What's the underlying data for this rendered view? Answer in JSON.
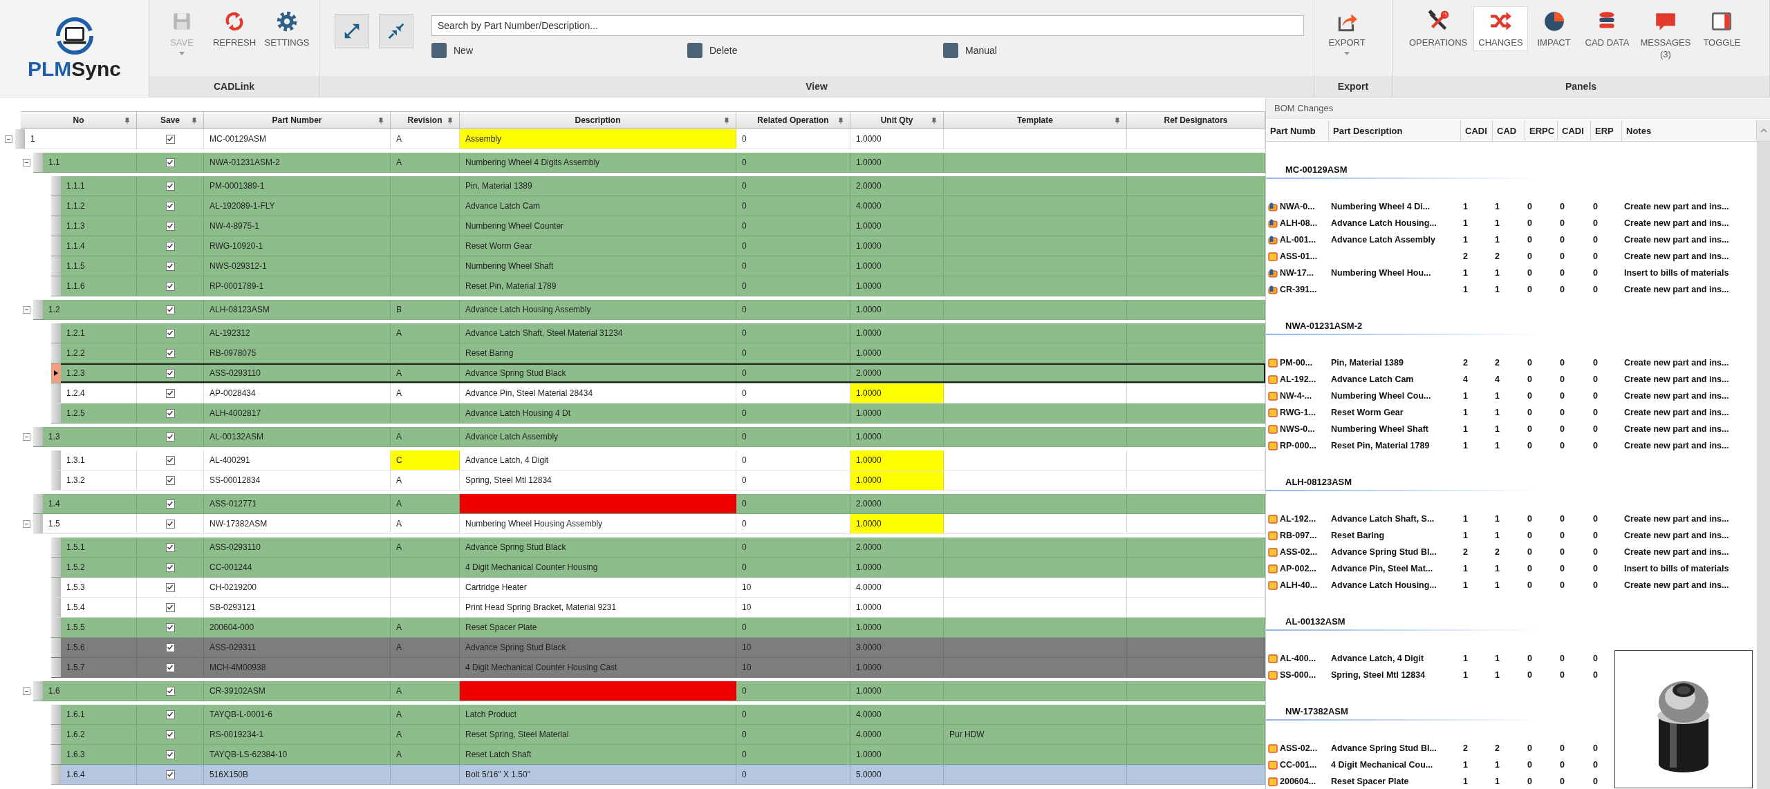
{
  "logo": {
    "accent": "PLM",
    "text": "Sync"
  },
  "ribbon": {
    "cadlink": {
      "label": "CADLink",
      "tools": [
        {
          "label": "SAVE",
          "disabled": true,
          "dropdown": true
        },
        {
          "label": "REFRESH",
          "disabled": false,
          "dropdown": false
        },
        {
          "label": "SETTINGS",
          "disabled": false,
          "dropdown": false
        }
      ]
    },
    "view": {
      "label": "View",
      "search": {
        "placeholder": "Search by Part Number/Description..."
      },
      "filters": [
        {
          "label": "New",
          "checked": false
        },
        {
          "label": "Delete",
          "checked": false
        },
        {
          "label": "Manual",
          "checked": false
        }
      ]
    },
    "export": {
      "label": "Export",
      "tools": [
        {
          "label": "EXPORT",
          "disabled": false,
          "dropdown": true
        }
      ]
    },
    "panels": {
      "label": "Panels",
      "tools": [
        {
          "label": "OPERATIONS",
          "selected": false
        },
        {
          "label": "CHANGES",
          "selected": true
        },
        {
          "label": "IMPACT",
          "selected": false
        },
        {
          "label": "CAD DATA",
          "selected": false
        },
        {
          "label": "MESSAGES",
          "count": "(3)",
          "selected": false
        },
        {
          "label": "TOGGLE",
          "selected": false
        }
      ]
    }
  },
  "grid": {
    "columns": [
      {
        "label": "No",
        "pinned": true
      },
      {
        "label": "Save",
        "pinned": true
      },
      {
        "label": "Part Number",
        "pinned": true
      },
      {
        "label": "Revision",
        "pinned": true
      },
      {
        "label": "Description",
        "pinned": true
      },
      {
        "label": "Related Operation",
        "pinned": true
      },
      {
        "label": "Unit Qty",
        "pinned": true
      },
      {
        "label": "Template",
        "pinned": true
      },
      {
        "label": "Ref Designators",
        "pinned": false
      }
    ],
    "rows": [
      {
        "no": "1",
        "save": true,
        "part_number": "MC-00129ASM",
        "revision": "A",
        "description": {
          "text": "Assembly",
          "color": "#ffff00"
        },
        "related_operation": "0",
        "unit_qty": "1.0000",
        "color": "#ffffff",
        "selected": false,
        "expanded": true,
        "children": [
          {
            "no": "1.1",
            "save": true,
            "part_number": "NWA-01231ASM-2",
            "revision": "A",
            "description": "Numbering Wheel 4 Digits Assembly",
            "related_operation": "0",
            "unit_qty": "1.0000",
            "color": "#8dbd8b",
            "selected": false,
            "expanded": true,
            "children": [
              {
                "no": "1.1.1",
                "save": true,
                "part_number": "PM-0001389-1",
                "description": "Pin, Material 1389",
                "related_operation": "0",
                "unit_qty": "2.0000",
                "color": "#8dbd8b",
                "selected": false
              },
              {
                "no": "1.1.2",
                "save": true,
                "part_number": "AL-192089-1-FLY",
                "description": "Advance Latch Cam",
                "related_operation": "0",
                "unit_qty": "4.0000",
                "color": "#8dbd8b",
                "selected": false
              },
              {
                "no": "1.1.3",
                "save": true,
                "part_number": "NW-4-8975-1",
                "description": "Numbering Wheel Counter",
                "related_operation": "0",
                "unit_qty": "1.0000",
                "color": "#8dbd8b",
                "selected": false
              },
              {
                "no": "1.1.4",
                "save": true,
                "part_number": "RWG-10920-1",
                "description": "Reset Worm Gear",
                "related_operation": "0",
                "unit_qty": "1.0000",
                "color": "#8dbd8b",
                "selected": false
              },
              {
                "no": "1.1.5",
                "save": true,
                "part_number": "NWS-029312-1",
                "description": "Numbering Wheel Shaft",
                "related_operation": "0",
                "unit_qty": "1.0000",
                "color": "#8dbd8b",
                "selected": false
              },
              {
                "no": "1.1.6",
                "save": true,
                "part_number": "RP-0001789-1",
                "description": "Reset Pin, Material 1789",
                "related_operation": "0",
                "unit_qty": "1.0000",
                "color": "#8dbd8b",
                "selected": false
              }
            ]
          },
          {
            "no": "1.2",
            "save": true,
            "part_number": "ALH-08123ASM",
            "revision": "B",
            "description": "Advance Latch Housing Assembly",
            "related_operation": "0",
            "unit_qty": "1.0000",
            "color": "#8dbd8b",
            "selected": false,
            "expanded": true,
            "children": [
              {
                "no": "1.2.1",
                "save": true,
                "part_number": "AL-192312",
                "revision": "A",
                "description": "Advance Latch Shaft, Steel Material 31234",
                "related_operation": "0",
                "unit_qty": "1.0000",
                "color": "#8dbd8b",
                "selected": false
              },
              {
                "no": "1.2.2",
                "save": true,
                "part_number": "RB-0978075",
                "description": "Reset  Baring",
                "related_operation": "0",
                "unit_qty": "1.0000",
                "color": "#8dbd8b",
                "selected": false
              },
              {
                "no": "1.2.3",
                "save": true,
                "part_number": "ASS-0293110",
                "revision": "A",
                "description": "Advance Spring Stud Black",
                "related_operation": "0",
                "unit_qty": "2.0000",
                "color": "#8dbd8b",
                "selected": true
              },
              {
                "no": "1.2.4",
                "save": true,
                "part_number": "AP-0028434",
                "revision": "A",
                "description": "Advance Pin, Steel Material 28434",
                "related_operation": "0",
                "unit_qty": {
                  "text": "1.0000",
                  "color": "#ffff00"
                },
                "color": "#ffffff",
                "selected": false
              },
              {
                "no": "1.2.5",
                "save": true,
                "part_number": "ALH-4002817",
                "description": "Advance Latch Housing 4 Dt",
                "related_operation": "0",
                "unit_qty": "1.0000",
                "color": "#8dbd8b",
                "selected": false
              }
            ]
          },
          {
            "no": "1.3",
            "save": true,
            "part_number": "AL-00132ASM",
            "revision": "A",
            "description": "Advance Latch Assembly",
            "related_operation": "0",
            "unit_qty": "1.0000",
            "color": "#8dbd8b",
            "selected": false,
            "expanded": true,
            "children": [
              {
                "no": "1.3.1",
                "save": true,
                "part_number": "AL-400291",
                "revision": {
                  "text": "C",
                  "color": "#ffff00"
                },
                "description": "Advance Latch, 4 Digit",
                "related_operation": "0",
                "unit_qty": {
                  "text": "1.0000",
                  "color": "#ffff00"
                },
                "color": "#ffffff",
                "selected": false
              },
              {
                "no": "1.3.2",
                "save": true,
                "part_number": "SS-00012834",
                "revision": "A",
                "description": "Spring, Steel Mtl 12834",
                "related_operation": "0",
                "unit_qty": {
                  "text": "1.0000",
                  "color": "#ffff00"
                },
                "color": "#ffffff",
                "selected": false
              }
            ]
          },
          {
            "no": "1.4",
            "save": true,
            "part_number": "ASS-012771",
            "revision": "A",
            "description": {
              "color": "#ee0000"
            },
            "related_operation": "0",
            "unit_qty": "2.0000",
            "color": "#8dbd8b",
            "selected": false
          },
          {
            "no": "1.5",
            "save": true,
            "part_number": "NW-17382ASM",
            "revision": "A",
            "description": "Numbering Wheel Housing Assembly",
            "related_operation": "0",
            "unit_qty": {
              "text": "1.0000",
              "color": "#ffff00"
            },
            "color": "#ffffff",
            "selected": false,
            "expanded": true,
            "children": [
              {
                "no": "1.5.1",
                "save": true,
                "part_number": "ASS-0293110",
                "revision": "A",
                "description": "Advance Spring Stud Black",
                "related_operation": "0",
                "unit_qty": "2.0000",
                "color": "#8dbd8b",
                "selected": false
              },
              {
                "no": "1.5.2",
                "save": true,
                "part_number": "CC-001244",
                "description": "4 Digit Mechanical Counter Housing",
                "related_operation": "0",
                "unit_qty": "1.0000",
                "color": "#8dbd8b",
                "selected": false
              },
              {
                "no": "1.5.3",
                "save": true,
                "part_number": "CH-0219200",
                "description": "Cartridge Heater",
                "related_operation": "10",
                "unit_qty": "4.0000",
                "color": "#ffffff",
                "selected": false
              },
              {
                "no": "1.5.4",
                "save": true,
                "part_number": "SB-0293121",
                "description": "Print Head Spring Bracket, Material 9231",
                "related_operation": "10",
                "unit_qty": "1.0000",
                "color": "#ffffff",
                "selected": false
              },
              {
                "no": "1.5.5",
                "save": true,
                "part_number": "200604-000",
                "revision": "A",
                "description": "Reset Spacer Plate",
                "related_operation": "0",
                "unit_qty": "1.0000",
                "color": "#8dbd8b",
                "selected": false
              },
              {
                "no": "1.5.6",
                "save": true,
                "part_number": "ASS-029311",
                "revision": "A",
                "description": "Advance Spring Stud Black",
                "related_operation": "10",
                "unit_qty": "3.0000",
                "color": "#7d7d7d",
                "selected": false
              },
              {
                "no": "1.5.7",
                "save": true,
                "part_number": "MCH-4M00938",
                "description": "4 Digit Mechanical Counter Housing Cast",
                "related_operation": "10",
                "unit_qty": "1.0000",
                "color": "#7d7d7d",
                "selected": false
              }
            ]
          },
          {
            "no": "1.6",
            "save": true,
            "part_number": "CR-39102ASM",
            "revision": "A",
            "description": {
              "color": "#ee0000"
            },
            "related_operation": "0",
            "unit_qty": "1.0000",
            "color": "#8dbd8b",
            "selected": false,
            "expanded": true,
            "children": [
              {
                "no": "1.6.1",
                "save": true,
                "part_number": "TAYQB-L-0001-6",
                "revision": "A",
                "description": "Latch Product",
                "related_operation": "0",
                "unit_qty": "4.0000",
                "color": "#8dbd8b",
                "selected": false
              },
              {
                "no": "1.6.2",
                "save": true,
                "part_number": "RS-0019234-1",
                "revision": "A",
                "description": "Reset Spring, Steel Material",
                "related_operation": "0",
                "unit_qty": "4.0000",
                "template": "Pur HDW",
                "color": "#8dbd8b",
                "selected": false
              },
              {
                "no": "1.6.3",
                "save": true,
                "part_number": "TAYQB-LS-62384-10",
                "revision": "A",
                "description": "Reset Latch Shaft",
                "related_operation": "0",
                "unit_qty": "1.0000",
                "color": "#8dbd8b",
                "selected": false
              },
              {
                "no": "1.6.4",
                "save": true,
                "part_number": "516X150B",
                "description": "Bolt 5/16\" X 1.50\"",
                "related_operation": "0",
                "unit_qty": "5.0000",
                "color": "#b4c6e0",
                "selected": false
              }
            ]
          }
        ]
      }
    ]
  },
  "bom_changes": {
    "title": "BOM Changes",
    "columns": [
      "Part Numb",
      "Part Description",
      "CADI",
      "CAD",
      "ERPC",
      "CADI",
      "ERP",
      "Notes"
    ],
    "groups": [
      {
        "assembly": "MC-00129ASM",
        "rows": [
          {
            "kind": "linked",
            "part": "NWA-0...",
            "description": "Numbering Wheel 4 Di...",
            "values": [
              "1",
              "1",
              "0",
              "0",
              "0"
            ],
            "notes": "Create new part and ins..."
          },
          {
            "kind": "linked",
            "part": "ALH-08...",
            "description": "Advance Latch Housing...",
            "values": [
              "1",
              "1",
              "0",
              "0",
              "0"
            ],
            "notes": "Create new part and ins..."
          },
          {
            "kind": "linked",
            "part": "AL-001...",
            "description": "Advance Latch Assembly",
            "values": [
              "1",
              "1",
              "0",
              "0",
              "0"
            ],
            "notes": "Create new part and ins..."
          },
          {
            "kind": "plain",
            "part": "ASS-01...",
            "values": [
              "2",
              "2",
              "0",
              "0",
              "0"
            ],
            "notes": "Create new part and ins..."
          },
          {
            "kind": "linked",
            "part": "NW-17...",
            "description": "Numbering Wheel Hou...",
            "values": [
              "1",
              "1",
              "0",
              "0",
              "0"
            ],
            "notes": "Insert to bills of materials"
          },
          {
            "kind": "linked",
            "part": "CR-391...",
            "values": [
              "1",
              "1",
              "0",
              "0",
              "0"
            ],
            "notes": "Create new part and ins..."
          }
        ]
      },
      {
        "assembly": "NWA-01231ASM-2",
        "rows": [
          {
            "kind": "plain",
            "part": "PM-00...",
            "description": "Pin, Material 1389",
            "values": [
              "2",
              "2",
              "0",
              "0",
              "0"
            ],
            "notes": "Create new part and ins..."
          },
          {
            "kind": "plain",
            "part": "AL-192...",
            "description": "Advance Latch Cam",
            "values": [
              "4",
              "4",
              "0",
              "0",
              "0"
            ],
            "notes": "Create new part and ins..."
          },
          {
            "kind": "plain",
            "part": "NW-4-...",
            "description": "Numbering Wheel Cou...",
            "values": [
              "1",
              "1",
              "0",
              "0",
              "0"
            ],
            "notes": "Create new part and ins..."
          },
          {
            "kind": "plain",
            "part": "RWG-1...",
            "description": "Reset Worm Gear",
            "values": [
              "1",
              "1",
              "0",
              "0",
              "0"
            ],
            "notes": "Create new part and ins..."
          },
          {
            "kind": "plain",
            "part": "NWS-0...",
            "description": "Numbering Wheel Shaft",
            "values": [
              "1",
              "1",
              "0",
              "0",
              "0"
            ],
            "notes": "Create new part and ins..."
          },
          {
            "kind": "plain",
            "part": "RP-000...",
            "description": "Reset Pin, Material 1789",
            "values": [
              "1",
              "1",
              "0",
              "0",
              "0"
            ],
            "notes": "Create new part and ins..."
          }
        ]
      },
      {
        "assembly": "ALH-08123ASM",
        "rows": [
          {
            "kind": "plain",
            "part": "AL-192...",
            "description": "Advance Latch Shaft, S...",
            "values": [
              "1",
              "1",
              "0",
              "0",
              "0"
            ],
            "notes": "Create new part and ins..."
          },
          {
            "kind": "plain",
            "part": "RB-097...",
            "description": "Reset  Baring",
            "values": [
              "1",
              "1",
              "0",
              "0",
              "0"
            ],
            "notes": "Create new part and ins..."
          },
          {
            "kind": "plain",
            "part": "ASS-02...",
            "description": "Advance Spring Stud Bl...",
            "values": [
              "2",
              "2",
              "0",
              "0",
              "0"
            ],
            "notes": "Create new part and ins..."
          },
          {
            "kind": "plain",
            "part": "AP-002...",
            "description": "Advance Pin, Steel Mat...",
            "values": [
              "1",
              "1",
              "0",
              "0",
              "0"
            ],
            "notes": "Insert to bills of materials"
          },
          {
            "kind": "plain",
            "part": "ALH-40...",
            "description": "Advance Latch Housing...",
            "values": [
              "1",
              "1",
              "0",
              "0",
              "0"
            ],
            "notes": "Create new part and ins..."
          }
        ]
      },
      {
        "assembly": "AL-00132ASM",
        "rows": [
          {
            "kind": "plain",
            "part": "AL-400...",
            "description": "Advance Latch, 4 Digit",
            "values": [
              "1",
              "1",
              "0",
              "0",
              "0"
            ]
          },
          {
            "kind": "plain",
            "part": "SS-000...",
            "description": "Spring, Steel Mtl 12834",
            "values": [
              "1",
              "1",
              "0",
              "0",
              "0"
            ]
          }
        ]
      },
      {
        "assembly": "NW-17382ASM",
        "rows": [
          {
            "kind": "plain",
            "part": "ASS-02...",
            "description": "Advance Spring Stud Bl...",
            "values": [
              "2",
              "2",
              "0",
              "0",
              "0"
            ]
          },
          {
            "kind": "plain",
            "part": "CC-001...",
            "description": "4 Digit Mechanical Cou...",
            "values": [
              "1",
              "1",
              "0",
              "0",
              "0"
            ]
          },
          {
            "kind": "plain",
            "part": "200604...",
            "description": "Reset Spacer Plate",
            "values": [
              "1",
              "1",
              "0",
              "0",
              "0"
            ]
          }
        ]
      }
    ]
  }
}
